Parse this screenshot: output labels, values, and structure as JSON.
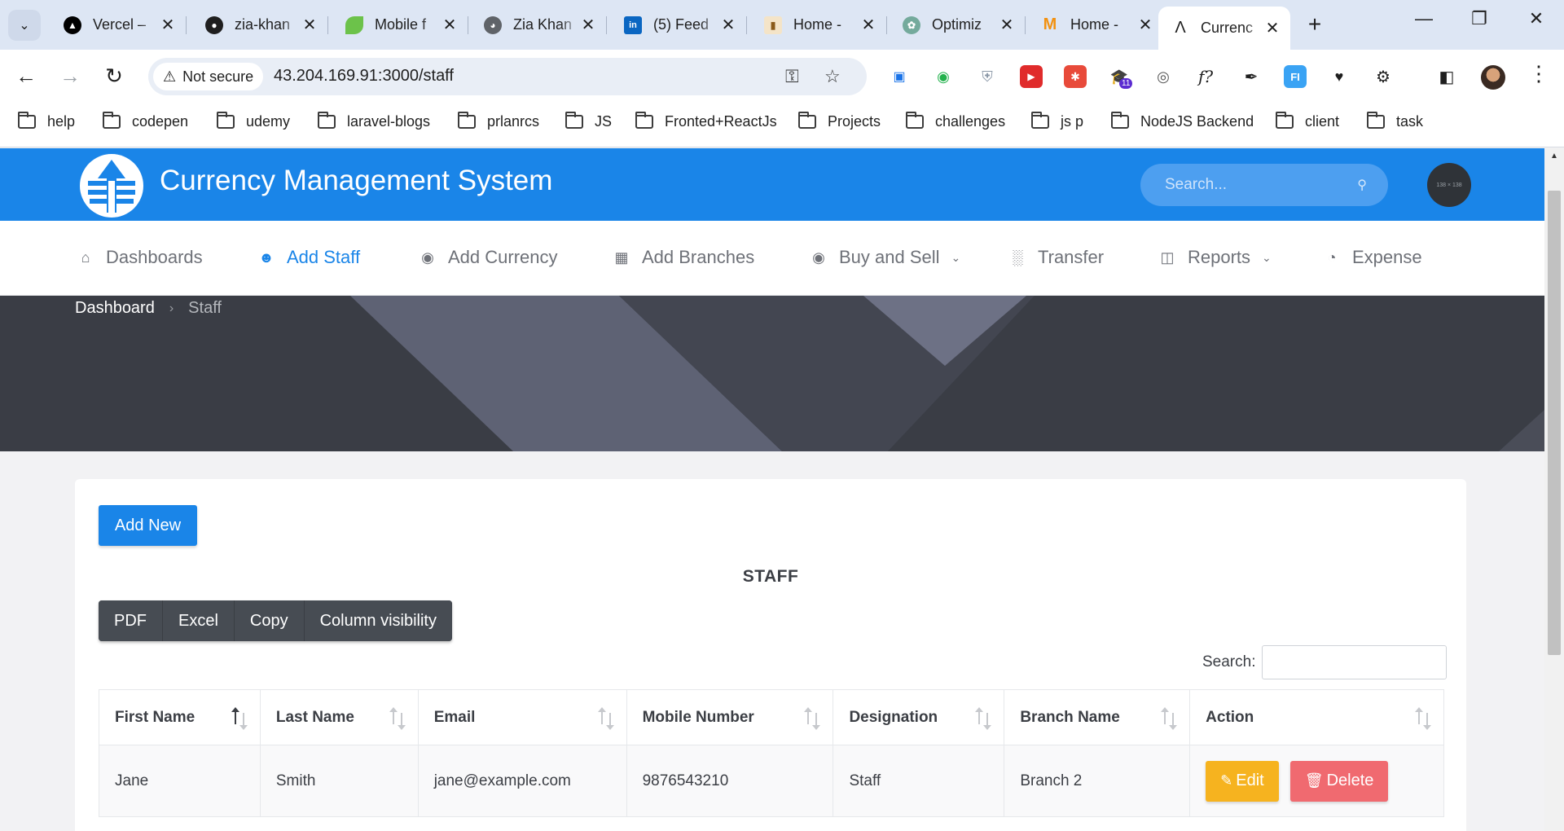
{
  "browser": {
    "tabs": [
      {
        "title": "Vercel – ",
        "icon": "vercel-icon",
        "active": false
      },
      {
        "title": "zia-khan",
        "icon": "github-icon",
        "active": false
      },
      {
        "title": "Mobile f",
        "icon": "leaf-icon",
        "active": false
      },
      {
        "title": "Zia Khan",
        "icon": "globe-icon",
        "active": false
      },
      {
        "title": "(5) Feed",
        "icon": "linkedin-icon",
        "active": false
      },
      {
        "title": "Home - ",
        "icon": "bookmark-icon",
        "active": false
      },
      {
        "title": "Optimiz",
        "icon": "chatgpt-icon",
        "active": false
      },
      {
        "title": "Home - ",
        "icon": "medium-icon",
        "active": false
      },
      {
        "title": "Currenc",
        "icon": "app-logo-icon",
        "active": true
      }
    ],
    "security_label": "Not secure",
    "url": "43.204.169.91:3000/staff",
    "extension_badge": "11",
    "extension_fx": "f?",
    "extension_fi": "FI",
    "bookmarks": [
      "help",
      "codepen",
      "udemy",
      "laravel-blogs",
      "prlanrcs",
      "JS",
      "Fronted+ReactJs",
      "Projects",
      "challenges",
      "js p",
      "NodeJS Backend",
      "client",
      "task"
    ]
  },
  "header": {
    "title": "Currency Management System",
    "search_placeholder": "Search...",
    "avatar_text": "138 × 138"
  },
  "nav": {
    "items": [
      {
        "label": "Dashboards",
        "icon": "home-icon",
        "active": false
      },
      {
        "label": "Add Staff",
        "icon": "users-icon",
        "active": true
      },
      {
        "label": "Add Currency",
        "icon": "coin-icon",
        "active": false
      },
      {
        "label": "Add Branches",
        "icon": "building-icon",
        "active": false
      },
      {
        "label": "Buy and Sell",
        "icon": "coin-icon",
        "active": false,
        "dropdown": true
      },
      {
        "label": "Transfer",
        "icon": "bank-transfer-icon",
        "active": false
      },
      {
        "label": "Reports",
        "icon": "report-icon",
        "active": false,
        "dropdown": true
      },
      {
        "label": "Expense",
        "icon": "pie-icon",
        "active": false
      }
    ]
  },
  "breadcrumb": {
    "home": "Dashboard",
    "current": "Staff"
  },
  "staff": {
    "add_button": "Add New",
    "title": "STAFF",
    "export_buttons": [
      "PDF",
      "Excel",
      "Copy",
      "Column visibility"
    ],
    "search_label": "Search:",
    "columns": [
      "First Name",
      "Last Name",
      "Email",
      "Mobile Number",
      "Designation",
      "Branch Name",
      "Action"
    ],
    "rows": [
      {
        "first_name": "Jane",
        "last_name": "Smith",
        "email": "jane@example.com",
        "mobile": "9876543210",
        "designation": "Staff",
        "branch": "Branch 2"
      }
    ],
    "edit_label": "Edit",
    "delete_label": "Delete"
  },
  "colors": {
    "brand": "#1a85e8",
    "edit": "#f6b31f",
    "delete": "#f06a70",
    "hero": "#3a3d45"
  }
}
